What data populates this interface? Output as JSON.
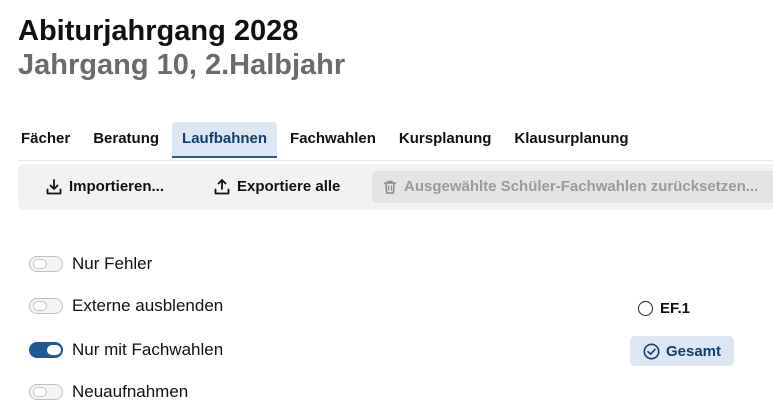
{
  "header": {
    "title": "Abiturjahrgang 2028",
    "subtitle": "Jahrgang 10, 2.Halbjahr"
  },
  "tabs": [
    {
      "label": "Fächer",
      "active": false
    },
    {
      "label": "Beratung",
      "active": false
    },
    {
      "label": "Laufbahnen",
      "active": true
    },
    {
      "label": "Fachwahlen",
      "active": false
    },
    {
      "label": "Kursplanung",
      "active": false
    },
    {
      "label": "Klausurplanung",
      "active": false
    }
  ],
  "toolbar": {
    "import_label": "Importieren...",
    "import_icon": "download-icon",
    "export_label": "Exportiere alle",
    "export_icon": "upload-icon",
    "reset_label": "Ausgewählte Schüler-Fachwahlen zurücksetzen...",
    "reset_icon": "trash-icon",
    "reset_disabled": true
  },
  "filters": [
    {
      "label": "Nur Fehler",
      "checked": false
    },
    {
      "label": "Externe ausblenden",
      "checked": false
    },
    {
      "label": "Nur mit Fachwahlen",
      "checked": true
    },
    {
      "label": "Neuaufnahmen",
      "checked": false
    }
  ],
  "scope": {
    "option_ef1": "EF.1",
    "option_gesamt": "Gesamt",
    "selected": "Gesamt"
  },
  "colors": {
    "accent": "#1f5a96",
    "active_tab_bg": "#dde7f3",
    "toolbar_bg": "#f2f2f3"
  }
}
